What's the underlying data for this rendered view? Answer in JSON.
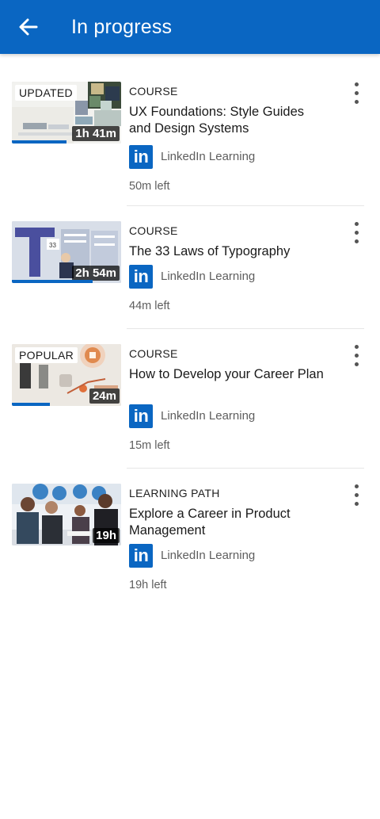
{
  "appbar": {
    "title": "In progress",
    "back_icon": "arrow-left-icon",
    "color": "#0a66c2"
  },
  "items": [
    {
      "badge": "UPDATED",
      "duration": "1h 41m",
      "progress": 0.5,
      "type": "COURSE",
      "title": "UX Foundations: Style Guides and Design Systems",
      "provider": "LinkedIn Learning",
      "provider_logo": "in",
      "time_left": "50m left"
    },
    {
      "badge": "",
      "duration": "2h 54m",
      "progress": 0.74,
      "type": "COURSE",
      "title": "The 33 Laws of Typography",
      "provider": "LinkedIn Learning",
      "provider_logo": "in",
      "time_left": "44m left"
    },
    {
      "badge": "POPULAR",
      "duration": "24m",
      "progress": 0.35,
      "type": "COURSE",
      "title": "How to Develop your Career Plan",
      "provider": "LinkedIn Learning",
      "provider_logo": "in",
      "time_left": "15m left"
    },
    {
      "badge": "",
      "duration": "19h",
      "progress": 0,
      "type": "LEARNING PATH",
      "title": "Explore a Career in Product Management",
      "provider": "LinkedIn Learning",
      "provider_logo": "in",
      "time_left": "19h left"
    }
  ]
}
